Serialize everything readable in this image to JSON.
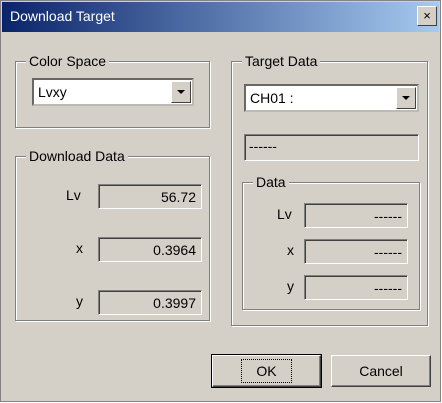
{
  "window": {
    "title": "Download Target",
    "close_glyph": "×"
  },
  "color_space": {
    "legend": "Color Space",
    "selected": "Lvxy"
  },
  "download_data": {
    "legend": "Download Data",
    "rows": [
      {
        "label": "Lv",
        "value": "56.72"
      },
      {
        "label": "x",
        "value": "0.3964"
      },
      {
        "label": "y",
        "value": "0.3997"
      }
    ]
  },
  "target_data": {
    "legend": "Target Data",
    "selected": "CH01 :",
    "name_field": "------",
    "data": {
      "legend": "Data",
      "rows": [
        {
          "label": "Lv",
          "value": "------"
        },
        {
          "label": "x",
          "value": "------"
        },
        {
          "label": "y",
          "value": "------"
        }
      ]
    }
  },
  "buttons": {
    "ok": "OK",
    "cancel": "Cancel"
  },
  "icons": {
    "dropdown": "chevron-down-icon"
  }
}
